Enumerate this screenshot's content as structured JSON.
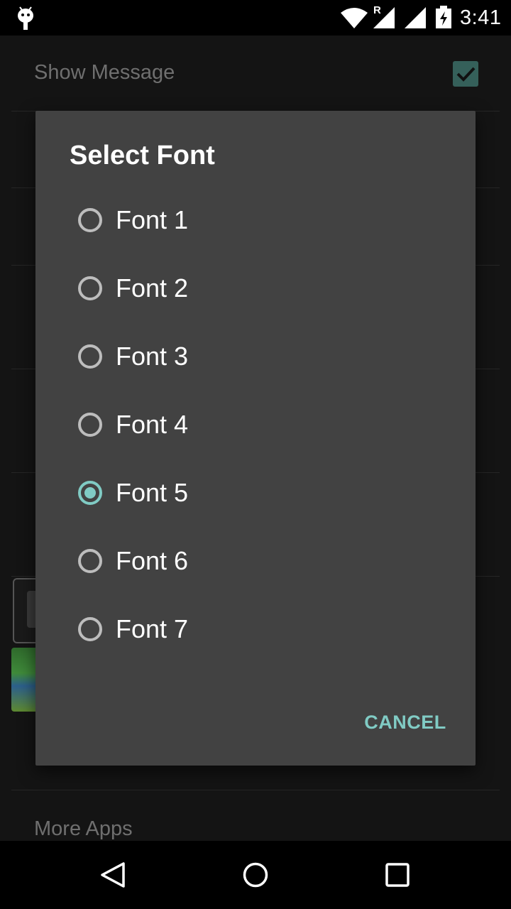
{
  "status_bar": {
    "time": "3:41",
    "icons": [
      "android-icon",
      "wifi-icon",
      "signal-r-icon",
      "signal-icon",
      "battery-charging-icon"
    ],
    "roaming_indicator": "R"
  },
  "settings": {
    "show_message_label": "Show Message",
    "show_message_checked": true,
    "more_apps_label": "More Apps"
  },
  "dialog": {
    "title": "Select Font",
    "options": [
      {
        "label": "Font 1",
        "selected": false
      },
      {
        "label": "Font 2",
        "selected": false
      },
      {
        "label": "Font 3",
        "selected": false
      },
      {
        "label": "Font 4",
        "selected": false
      },
      {
        "label": "Font 5",
        "selected": true
      },
      {
        "label": "Font 6",
        "selected": false
      },
      {
        "label": "Font 7",
        "selected": false
      }
    ],
    "cancel_label": "CANCEL"
  },
  "colors": {
    "accent": "#80cbc4",
    "dialog_background": "#424242",
    "app_background": "#141414"
  },
  "nav_bar": {
    "icons": [
      "back-icon",
      "home-icon",
      "recents-icon"
    ]
  }
}
